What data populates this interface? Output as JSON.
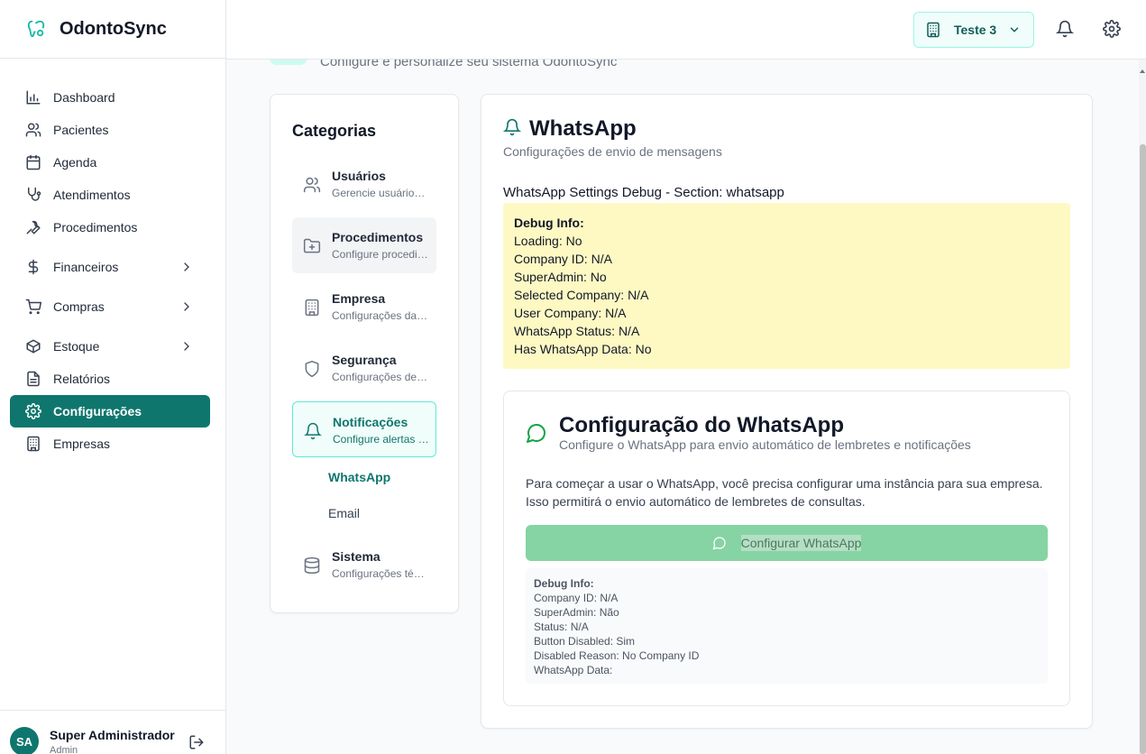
{
  "app": {
    "name": "OdontoSync"
  },
  "sidebar": {
    "items": [
      {
        "label": "Dashboard",
        "icon": "bar-chart-icon"
      },
      {
        "label": "Pacientes",
        "icon": "users-icon"
      },
      {
        "label": "Agenda",
        "icon": "calendar-icon"
      },
      {
        "label": "Atendimentos",
        "icon": "stethoscope-icon"
      },
      {
        "label": "Procedimentos",
        "icon": "wrench-icon"
      },
      {
        "label": "Financeiros",
        "icon": "dollar-icon"
      },
      {
        "label": "Compras",
        "icon": "cart-icon"
      },
      {
        "label": "Estoque",
        "icon": "package-icon"
      },
      {
        "label": "Relatórios",
        "icon": "file-icon"
      },
      {
        "label": "Configurações",
        "icon": "gear-icon"
      },
      {
        "label": "Empresas",
        "icon": "building-icon"
      }
    ],
    "active": "Configurações"
  },
  "user": {
    "initials": "SA",
    "name": "Super Administrador",
    "role": "Admin"
  },
  "topbar": {
    "company": "Teste 3"
  },
  "page": {
    "subtitle": "Configure e personalize seu sistema OdontoSync"
  },
  "categories": {
    "title": "Categorias",
    "items": [
      {
        "title": "Usuários",
        "desc": "Gerencie usuários e permissões"
      },
      {
        "title": "Procedimentos",
        "desc": "Configure procedimentos"
      },
      {
        "title": "Empresa",
        "desc": "Configurações da empresa"
      },
      {
        "title": "Segurança",
        "desc": "Configurações de segurança"
      },
      {
        "title": "Notificações",
        "desc": "Configure alertas e notificações"
      },
      {
        "title": "Sistema",
        "desc": "Configurações técnicas"
      }
    ],
    "subitems": [
      "WhatsApp",
      "Email"
    ]
  },
  "whatsapp": {
    "title": "WhatsApp",
    "subtitle": "Configurações de envio de mensagens",
    "debug_heading": "WhatsApp Settings Debug - Section: whatsapp",
    "debug": {
      "title": "Debug Info:",
      "lines": [
        "Loading: No",
        "Company ID: N/A",
        "SuperAdmin: No",
        "Selected Company: N/A",
        "User Company: N/A",
        "WhatsApp Status: N/A",
        "Has WhatsApp Data: No"
      ]
    },
    "config": {
      "title": "Configuração do WhatsApp",
      "subtitle": "Configure o WhatsApp para envio automático de lembretes e notificações",
      "paragraph1": "Para começar a usar o WhatsApp, você precisa configurar uma instância para sua empresa.",
      "paragraph2": "Isso permitirá o envio automático de lembretes de consultas.",
      "button": "Configurar WhatsApp",
      "debug": {
        "title": "Debug Info:",
        "lines": [
          "Company ID: N/A",
          "SuperAdmin: Não",
          "Status: N/A",
          "Button Disabled: Sim",
          "Disabled Reason: No Company ID",
          "WhatsApp Data:"
        ]
      }
    }
  },
  "colors": {
    "accent": "#0f766e",
    "debug_bg": "#fef9c3",
    "button_disabled": "#86d3a3"
  }
}
